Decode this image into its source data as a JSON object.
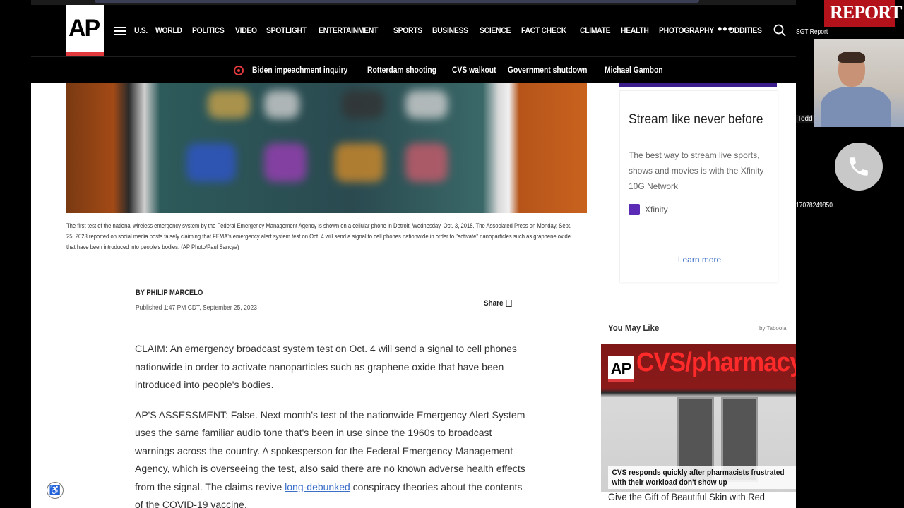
{
  "nav": {
    "logo": "AP",
    "items": [
      "U.S.",
      "WORLD",
      "POLITICS",
      "VIDEO",
      "SPOTLIGHT",
      "ENTERTAINMENT",
      "SPORTS",
      "BUSINESS",
      "SCIENCE",
      "FACT CHECK",
      "CLIMATE",
      "HEALTH",
      "PHOTOGRAPHY",
      "ODDITIES"
    ],
    "more": "•••"
  },
  "trending": [
    "Biden impeachment inquiry",
    "Rotterdam shooting",
    "CVS walkout",
    "Government shutdown",
    "Michael Gambon"
  ],
  "article": {
    "caption": "The first test of the national wireless emergency system by the Federal Emergency Management Agency is shown on a cellular phone in Detroit, Wednesday, Oct. 3, 2018. The Associated Press on Monday, Sept. 25, 2023 reported on social media posts falsely claiming that FEMA's emergency alert system test on Oct. 4 will send a signal to cell phones nationwide in order to \"activate\" nanoparticles such as graphene oxide that have been introduced into people's bodies. (AP Photo/Paul Sancya)",
    "byline": "BY PHILIP MARCELO",
    "published": "Published 1:47 PM CDT, September 25, 2023",
    "share": "Share",
    "p1": "CLAIM: An emergency broadcast system test on Oct. 4 will send a signal to cell phones nationwide in order to activate nanoparticles such as graphene oxide that have been introduced into people's bodies.",
    "p2_before": "AP'S ASSESSMENT: False. Next month's test of the nationwide Emergency Alert System uses the same familiar audio tone that's been in use since the 1960s to broadcast warnings across the country. A spokesperson for the Federal Emergency Management Agency, which is overseeing the test, also said there are no known adverse health effects from the signal. The claims revive ",
    "p2_link": "long-debunked",
    "p2_after": " conspiracy theories about the contents of the COVID-19 vaccine."
  },
  "ad": {
    "title": "Stream like never before",
    "body": "The best way to stream live sports, shows and movies is with the Xfinity 10G Network",
    "brand": "Xfinity",
    "cta": "Learn more"
  },
  "you_may_like": {
    "title": "You May Like",
    "by": "by Taboola",
    "promo_logo": "AP",
    "promo_sign": "CVS/pharmacy",
    "promo_caption": "CVS responds quickly after pharmacists frustrated with their workload don't show up",
    "next_headline": "Give the Gift of Beautiful Skin with Red"
  },
  "overlay": {
    "banner": "REPORT",
    "label": "SGT Report",
    "name_tag": "Todd",
    "phone": "17078249850"
  },
  "colors": {
    "ap_red": "#e03a3e",
    "link": "#3b6fc9",
    "xfinity_purple": "#5b2bb5"
  }
}
